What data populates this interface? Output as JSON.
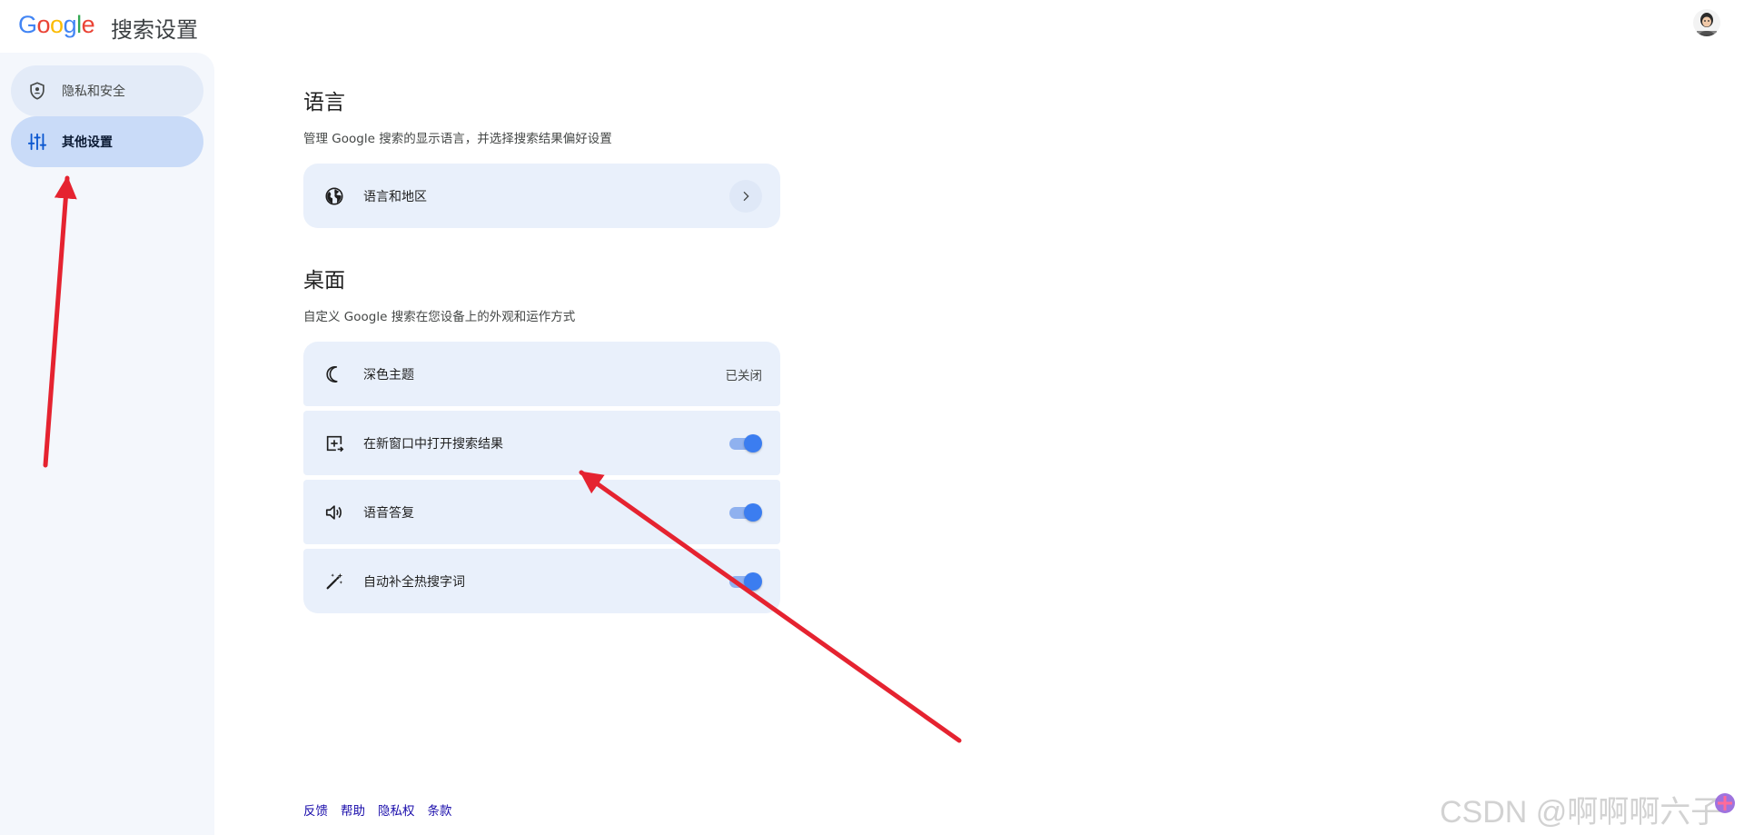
{
  "header": {
    "logo": {
      "letters": [
        "G",
        "o",
        "o",
        "g",
        "l",
        "e"
      ],
      "colors": [
        "#4285F4",
        "#EA4335",
        "#FBBC05",
        "#4285F4",
        "#34A853",
        "#EA4335"
      ]
    },
    "title": "搜索设置"
  },
  "sidebar": {
    "items": [
      {
        "label": "隐私和安全",
        "icon": "shield-icon"
      },
      {
        "label": "其他设置",
        "icon": "sliders-icon",
        "selected": true
      }
    ]
  },
  "main": {
    "language": {
      "title": "语言",
      "description": "管理 Google 搜索的显示语言，并选择搜索结果偏好设置",
      "items": [
        {
          "label": "语言和地区",
          "icon": "globe-icon"
        }
      ]
    },
    "desktop": {
      "title": "桌面",
      "description": "自定义 Google 搜索在您设备上的外观和运作方式",
      "items": [
        {
          "label": "深色主题",
          "icon": "moon-icon",
          "status": "已关闭"
        },
        {
          "label": "在新窗口中打开搜索结果",
          "icon": "new-window-icon",
          "toggle": true
        },
        {
          "label": "语音答复",
          "icon": "speaker-icon",
          "toggle": true
        },
        {
          "label": "自动补全热搜字词",
          "icon": "magic-wand-icon",
          "toggle": true
        }
      ]
    }
  },
  "footer": {
    "links": [
      "反馈",
      "帮助",
      "隐私权",
      "条款"
    ]
  },
  "watermark": "CSDN @啊啊啊六子",
  "colors": {
    "accent": "#3b7df0",
    "annotation_arrow": "#e52330"
  }
}
